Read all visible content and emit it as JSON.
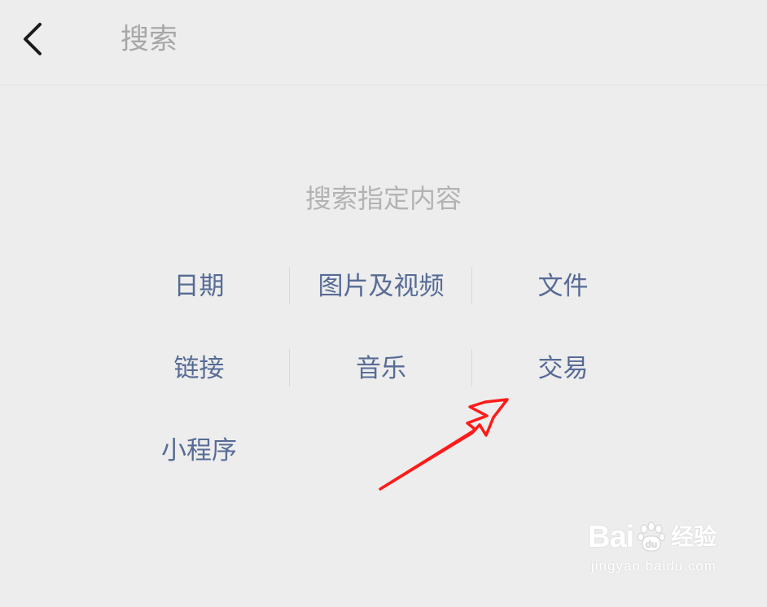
{
  "header": {
    "back_icon": "chevron-left-icon",
    "search_placeholder": "搜索"
  },
  "search_section": {
    "title": "搜索指定内容",
    "options": [
      {
        "label": "日期"
      },
      {
        "label": "图片及视频"
      },
      {
        "label": "文件"
      },
      {
        "label": "链接"
      },
      {
        "label": "音乐"
      },
      {
        "label": "交易"
      },
      {
        "label": "小程序"
      }
    ]
  },
  "annotation": {
    "arrow_color": "#ff1a1a"
  },
  "watermark": {
    "logo_prefix": "Bai",
    "logo_suffix": "经验",
    "url": "jingyan.baidu.com"
  },
  "colors": {
    "background": "#ededed",
    "link": "#576b95",
    "hint": "#b3b3b3"
  }
}
